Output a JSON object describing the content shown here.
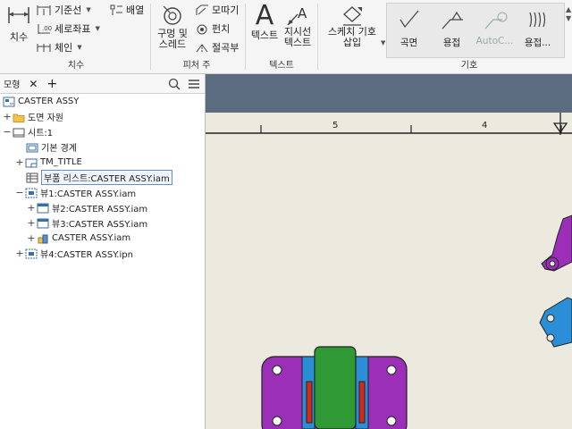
{
  "ribbon": {
    "dimension": {
      "big_label": "치수",
      "baseline_label": "기준선",
      "ordinate_label": "세로좌표",
      "chain_label": "체인",
      "arrange_label": "배열",
      "group_label": "치수"
    },
    "feature_notes": {
      "hole_thread_label": "구멍 및\n스레드",
      "chamfer_label": "모따기",
      "bend_label": "펀치",
      "fold_label": "절곡부",
      "group_label": "피처 주"
    },
    "text": {
      "text_label": "텍스트",
      "leader_text_label": "지시선\n텍스트",
      "group_label": "텍스트"
    },
    "symbols": {
      "sketch_symbol_label": "스케치 기호\n삽입",
      "surface_label": "곡면",
      "weld_label": "용접",
      "autocad_label": "AutoC...",
      "weld2_label": "용접...",
      "group_label": "기호"
    }
  },
  "browser": {
    "tab_label": "모형",
    "close_symbol": "✕",
    "add_symbol": "+",
    "items": [
      {
        "label": "CASTER ASSY",
        "expander": "",
        "icon": "drawing-icon"
      },
      {
        "label": "도면 자원",
        "expander": "+",
        "icon": "folder-icon"
      },
      {
        "label": "시트:1",
        "expander": "−",
        "icon": "sheet-icon"
      },
      {
        "label": "기본 경계",
        "expander": "",
        "icon": "border-icon"
      },
      {
        "label": "TM_TITLE",
        "expander": "+",
        "icon": "title-block-icon"
      },
      {
        "label": "부품 리스트:CASTER ASSY.iam",
        "expander": "",
        "icon": "parts-list-icon"
      },
      {
        "label": "뷰1:CASTER ASSY.iam",
        "expander": "−",
        "icon": "view-icon"
      },
      {
        "label": "뷰2:CASTER ASSY.iam",
        "expander": "+",
        "icon": "view-icon"
      },
      {
        "label": "뷰3:CASTER ASSY.iam",
        "expander": "+",
        "icon": "view-icon"
      },
      {
        "label": "CASTER ASSY.iam",
        "expander": "+",
        "icon": "assembly-icon"
      },
      {
        "label": "뷰4:CASTER ASSY.ipn",
        "expander": "+",
        "icon": "view-icon"
      }
    ]
  },
  "canvas": {
    "ruler_labels": [
      "5",
      "4"
    ]
  },
  "colors": {
    "part_purple": "#9b2fb8",
    "part_green": "#2f9a35",
    "part_blue": "#2a8fd6",
    "part_red": "#d42a1a",
    "title_strip": "#5c6c80",
    "sheet_bg": "#ece9df"
  }
}
